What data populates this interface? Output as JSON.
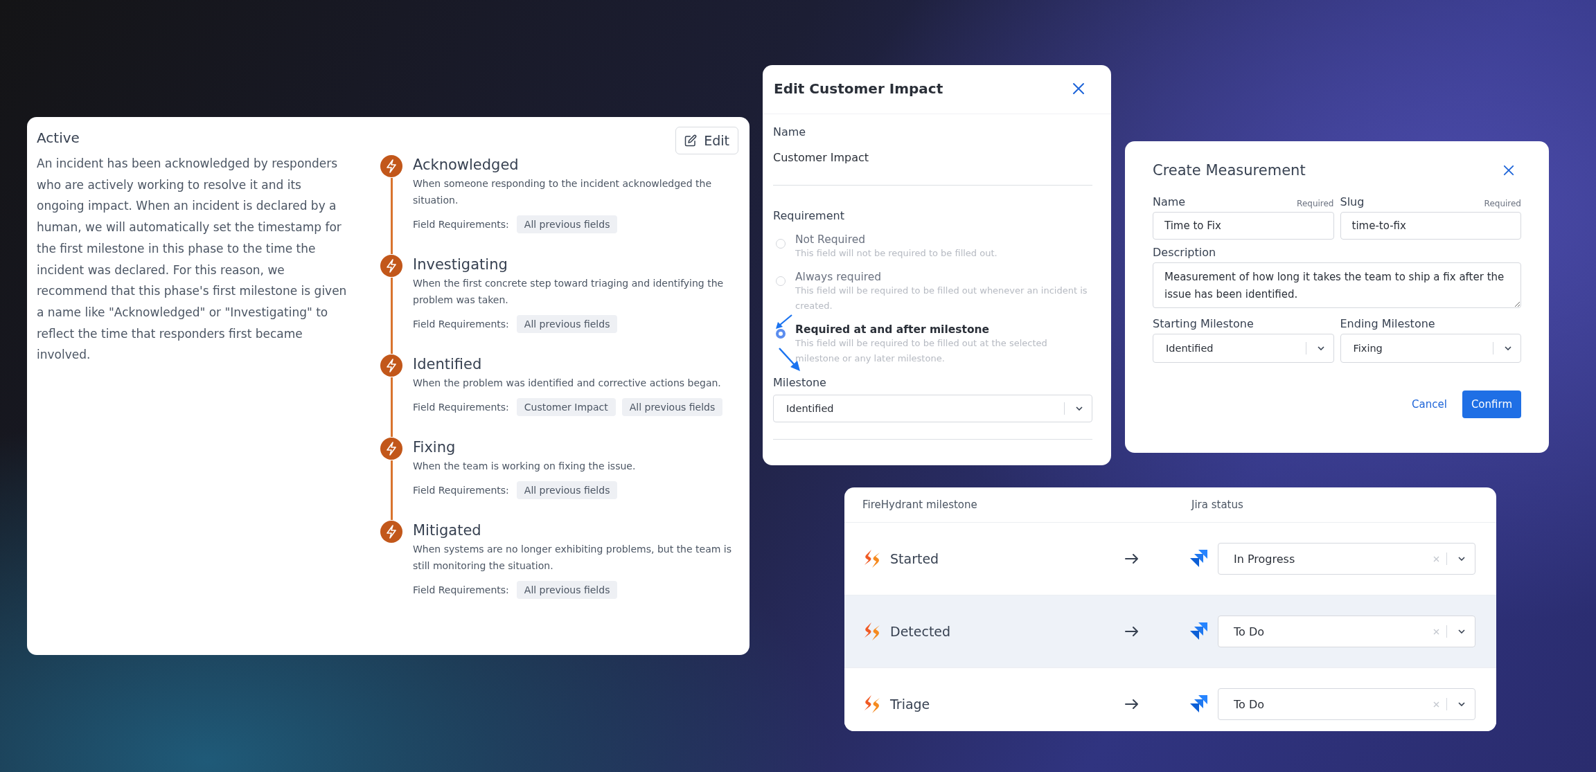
{
  "active_phase": {
    "title": "Active",
    "edit_button": "Edit",
    "description": "An incident has been acknowledged by responders who are actively working to resolve it and its ongoing impact. When an incident is declared by a human, we will automatically set the timestamp for the first milestone in this phase to the time the incident was declared. For this reason, we recommend that this phase's first milestone is given a name like \"Acknowledged\" or \"Investigating\" to reflect the time that responders first became involved.",
    "milestones": [
      {
        "name": "Acknowledged",
        "description": "When someone responding to the incident acknowledged the situation.",
        "requirements_label": "Field Requirements:",
        "requirements": [
          "All previous fields"
        ]
      },
      {
        "name": "Investigating",
        "description": "When the first concrete step toward triaging and identifying the problem was taken.",
        "requirements_label": "Field Requirements:",
        "requirements": [
          "All previous fields"
        ]
      },
      {
        "name": "Identified",
        "description": "When the problem was identified and corrective actions began.",
        "requirements_label": "Field Requirements:",
        "requirements": [
          "Customer Impact",
          "All previous fields"
        ]
      },
      {
        "name": "Fixing",
        "description": "When the team is working on fixing the issue.",
        "requirements_label": "Field Requirements:",
        "requirements": [
          "All previous fields"
        ]
      },
      {
        "name": "Mitigated",
        "description": "When systems are no longer exhibiting problems, but the team is still monitoring the situation.",
        "requirements_label": "Field Requirements:",
        "requirements": [
          "All previous fields"
        ]
      }
    ]
  },
  "edit_customer_impact": {
    "title": "Edit Customer Impact",
    "name_label": "Name",
    "name_value": "Customer Impact",
    "requirement_label": "Requirement",
    "options": [
      {
        "label": "Not Required",
        "description": "This field will not be required to be filled out.",
        "selected": false
      },
      {
        "label": "Always required",
        "description": "This field will be required to be filled out whenever an incident is created.",
        "selected": false
      },
      {
        "label": "Required at and after milestone",
        "description": "This field will be required to be filled out at the selected milestone or any later milestone.",
        "selected": true
      }
    ],
    "milestone_label": "Milestone",
    "milestone_value": "Identified"
  },
  "create_measurement": {
    "title": "Create Measurement",
    "name_label": "Name",
    "name_required": "Required",
    "name_value": "Time to Fix",
    "slug_label": "Slug",
    "slug_required": "Required",
    "slug_value": "time-to-fix",
    "description_label": "Description",
    "description_value": "Measurement of how long it takes the team to ship a fix after the issue has been identified.",
    "starting_label": "Starting Milestone",
    "starting_value": "Identified",
    "ending_label": "Ending Milestone",
    "ending_value": "Fixing",
    "cancel_button": "Cancel",
    "confirm_button": "Confirm"
  },
  "milestone_mapping": {
    "columns": [
      "FireHydrant milestone",
      "Jira status"
    ],
    "rows": [
      {
        "milestone": "Started",
        "status": "In Progress",
        "highlighted": false
      },
      {
        "milestone": "Detected",
        "status": "To Do",
        "highlighted": true
      },
      {
        "milestone": "Triage",
        "status": "To Do",
        "highlighted": false
      }
    ]
  }
}
